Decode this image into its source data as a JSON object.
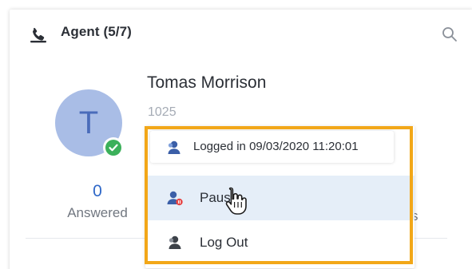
{
  "panel": {
    "title": "Agent (5/7)",
    "header_icon": "phone-icon",
    "search_icon": "search-icon"
  },
  "agent": {
    "avatar_initial": "T",
    "name": "Tomas Morrison",
    "extension": "1025",
    "status_icon": "check-icon",
    "status_color": "#3bb05a",
    "avatar_color": "#a9bde6"
  },
  "stats": {
    "answered_value": "0",
    "answered_label": "Answered",
    "partial_label": "s"
  },
  "dropdown": {
    "status_text": "Logged in 09/03/2020 11:20:01",
    "status_icon": "agent-logged-in-icon",
    "items": [
      {
        "label": "Pause",
        "icon": "agent-pause-icon"
      },
      {
        "label": "Log Out",
        "icon": "agent-logout-icon"
      }
    ]
  },
  "colors": {
    "accent": "#2f68c8",
    "highlight_frame": "#f2a718",
    "hover_row": "#e5eef8"
  }
}
